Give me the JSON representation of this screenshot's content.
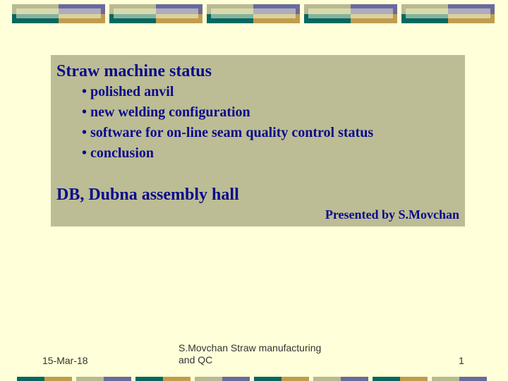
{
  "slide": {
    "title": "Straw machine status",
    "bullets": [
      "• polished anvil",
      "• new welding configuration",
      "• software for on-line seam quality control status",
      "• conclusion"
    ],
    "subtitle": "DB, Dubna assembly hall",
    "presenter": "Presented by S.Movchan"
  },
  "footer": {
    "date": "15-Mar-18",
    "center_line1": "S.Movchan Straw manufacturing",
    "center_line2": "and QC",
    "page_number": "1"
  },
  "theme": {
    "background": "#ffffd9",
    "panel": "#bcbd94",
    "text": "#0a0a8c",
    "teal": "#046860",
    "gold": "#c09d4c",
    "khaki": "#b9b992",
    "purple": "#6a6a9c"
  }
}
